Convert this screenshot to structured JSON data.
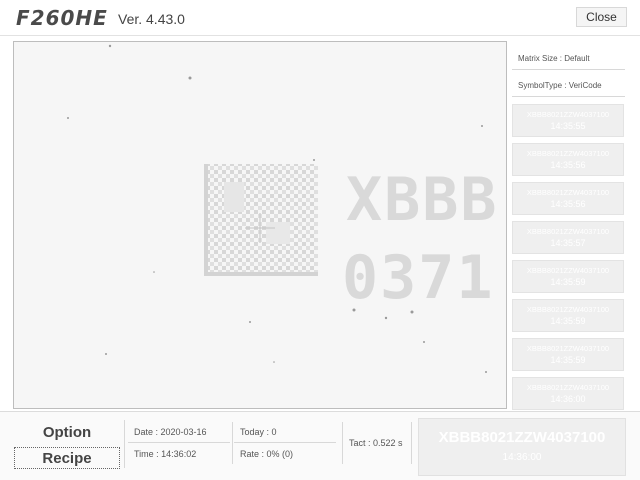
{
  "header": {
    "logo": "F260HE",
    "version": "Ver. 4.43.0",
    "close_label": "Close"
  },
  "camera": {
    "text_line1": "XBBB",
    "text_line2": "0371"
  },
  "side_panel": {
    "matrix_size": "Matrix Size : Default",
    "symbol_type": "SymbolType : VeriCode",
    "history": [
      {
        "code": "XBBB8021ZZW4037100",
        "time": "14:35:55"
      },
      {
        "code": "XBBB8021ZZW4037100",
        "time": "14:35:56"
      },
      {
        "code": "XBBB8021ZZW4037100",
        "time": "14:35:56"
      },
      {
        "code": "XBBB8021ZZW4037100",
        "time": "14:35:57"
      },
      {
        "code": "XBBB8021ZZW4037100",
        "time": "14:35:59"
      },
      {
        "code": "XBBB8021ZZW4037100",
        "time": "14:35:59"
      },
      {
        "code": "XBBB8021ZZW4037100",
        "time": "14:35:59"
      },
      {
        "code": "XBBB8021ZZW4037100",
        "time": "14:36:00"
      }
    ]
  },
  "bottom": {
    "option_label": "Option",
    "recipe_label": "Recipe",
    "date": "Date : 2020-03-16",
    "time": "Time : 14:36:02",
    "today": "Today : 0",
    "rate": "Rate : 0% (0)",
    "tact": "Tact : 0.522 s",
    "result_code": "XBBB8021ZZW4037100",
    "result_time": "14:36:00"
  }
}
